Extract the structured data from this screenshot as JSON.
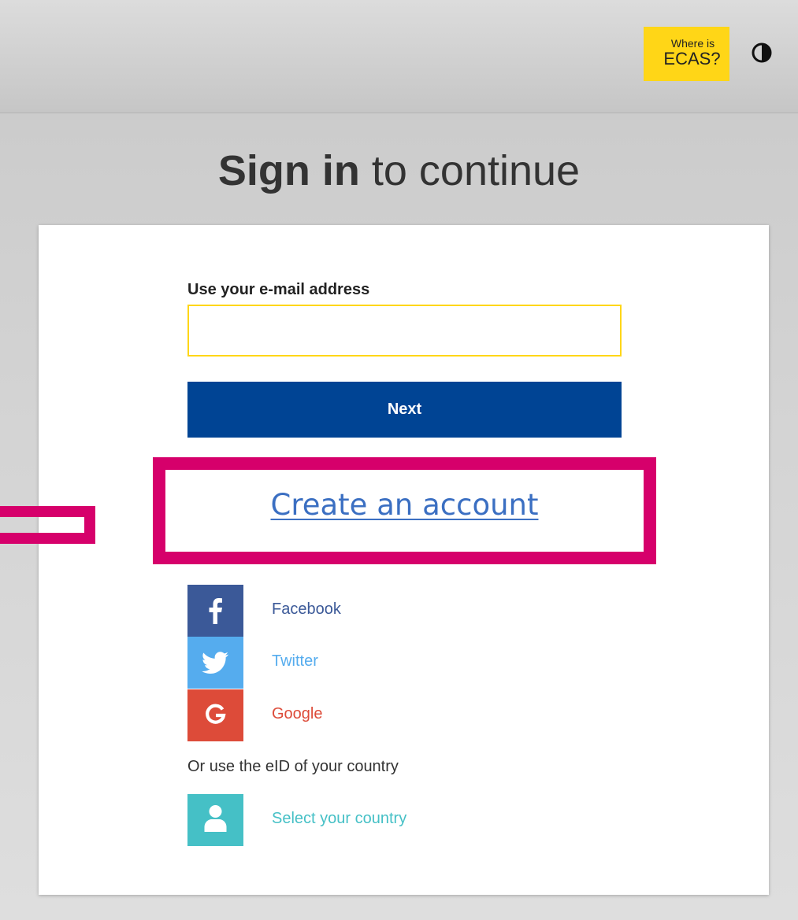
{
  "header": {
    "ecas_badge": {
      "line1": "Where is",
      "line2": "ECAS?",
      "color": "#ffd617"
    },
    "contrast_icon": "contrast-icon"
  },
  "title": {
    "bold": "Sign in",
    "rest": " to continue"
  },
  "form": {
    "email_label": "Use your e-mail address",
    "email_value": "",
    "email_placeholder": "",
    "next_label": "Next",
    "next_color": "#004494"
  },
  "create_account": {
    "label": "Create an account",
    "highlight_color": "#d6006b"
  },
  "social": [
    {
      "label": "Facebook",
      "icon": "facebook-icon",
      "color": "#3b5998",
      "text_color": "#3b5998"
    },
    {
      "label": "Twitter",
      "icon": "twitter-icon",
      "color": "#55acee",
      "text_color": "#55acee"
    },
    {
      "label": "Google",
      "icon": "google-icon",
      "color": "#dd4b39",
      "text_color": "#dd4b39"
    }
  ],
  "eid": {
    "text": "Or use the eID of your country",
    "select_label": "Select your country",
    "icon": "person-icon",
    "color": "#45c0c6"
  }
}
